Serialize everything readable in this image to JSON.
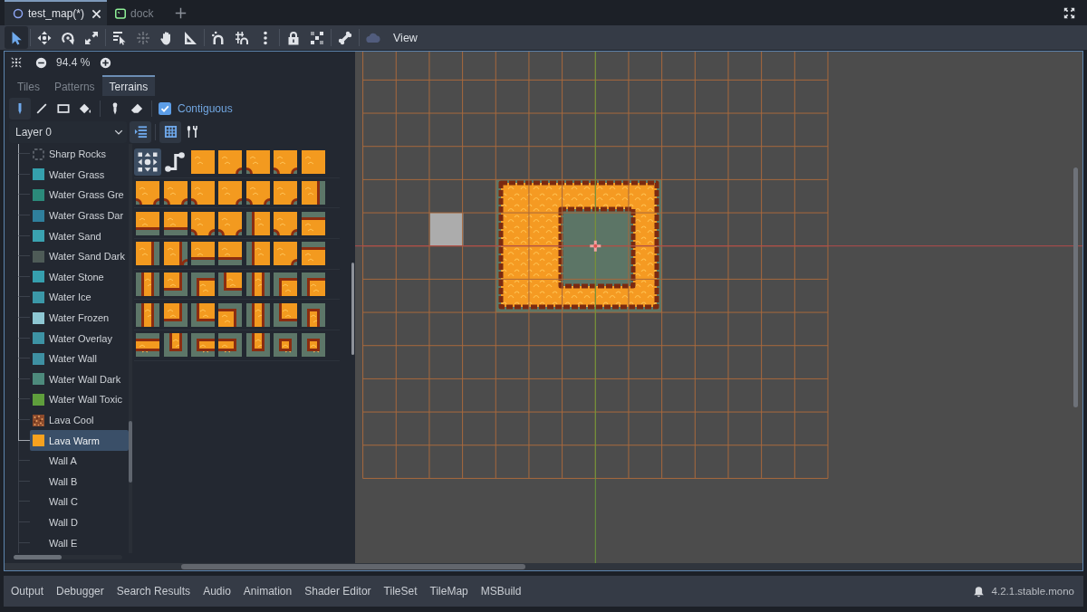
{
  "editor_tabs": [
    {
      "label": "test_map(*)",
      "kind": "circle",
      "selected": true
    },
    {
      "label": "dock",
      "kind": "square",
      "selected": false
    }
  ],
  "toolbar": {
    "tools": [
      {
        "selected": true,
        "disabled": false
      },
      {
        "selected": false,
        "disabled": false
      },
      {
        "selected": false,
        "disabled": false
      },
      {
        "selected": false,
        "disabled": false
      },
      {
        "selected": false,
        "disabled": false
      },
      {
        "selected": false,
        "disabled": true
      },
      {
        "selected": false,
        "disabled": false
      },
      {
        "selected": false,
        "disabled": false
      },
      {
        "selected": false,
        "disabled": false
      },
      {
        "selected": false,
        "disabled": false
      },
      {
        "selected": false,
        "disabled": false
      },
      {
        "selected": false,
        "disabled": false
      },
      {
        "selected": false,
        "disabled": false
      },
      {
        "selected": false,
        "disabled": false
      },
      {
        "selected": false,
        "disabled": true
      }
    ],
    "view_menu": "View"
  },
  "tile_panel": {
    "zoom": "94.4 %",
    "tabs": [
      {
        "label": "Tiles",
        "selected": false
      },
      {
        "label": "Patterns",
        "selected": false
      },
      {
        "label": "Terrains",
        "selected": true
      }
    ],
    "paint_tools": [
      {
        "selected": true
      },
      {
        "selected": false
      },
      {
        "selected": false
      },
      {
        "selected": false
      },
      {
        "selected": false
      },
      {
        "selected": false
      }
    ],
    "contiguous": {
      "label": "Contiguous",
      "checked": true
    },
    "layer": {
      "value": "Layer 0"
    },
    "view_toggles": [
      {
        "selected": true
      },
      {
        "selected": true
      },
      {
        "selected": false
      }
    ],
    "terrains": [
      {
        "name": "Sharp Rocks",
        "kind": "outline",
        "selected": false
      },
      {
        "name": "Water Grass",
        "kind": "color",
        "color": "#35a0ad",
        "selected": false
      },
      {
        "name": "Water Grass Gre",
        "kind": "color",
        "color": "#2b8a7a",
        "selected": false
      },
      {
        "name": "Water Grass Dar",
        "kind": "color",
        "color": "#2f7f9c",
        "selected": false
      },
      {
        "name": "Water Sand",
        "kind": "color",
        "color": "#3aa2b0",
        "selected": false
      },
      {
        "name": "Water Sand Dark",
        "kind": "color",
        "color": "#4e5b57",
        "selected": false
      },
      {
        "name": "Water Stone",
        "kind": "color",
        "color": "#369fae",
        "selected": false
      },
      {
        "name": "Water Ice",
        "kind": "color",
        "color": "#3b98a8",
        "selected": false
      },
      {
        "name": "Water Frozen",
        "kind": "color",
        "color": "#8ec7d3",
        "selected": false
      },
      {
        "name": "Water Overlay",
        "kind": "color",
        "color": "#3d93a4",
        "selected": false
      },
      {
        "name": "Water Wall",
        "kind": "color",
        "color": "#3e90a2",
        "selected": false
      },
      {
        "name": "Water Wall Dark",
        "kind": "color",
        "color": "#4d8a7c",
        "selected": false
      },
      {
        "name": "Water Wall Toxic",
        "kind": "color",
        "color": "#5f9e3c",
        "selected": false
      },
      {
        "name": "Lava Cool",
        "kind": "texture",
        "color": "#8b4a2b",
        "selected": false
      },
      {
        "name": "Lava Warm",
        "kind": "color",
        "color": "#f7a21f",
        "selected": true
      },
      {
        "name": "Wall A",
        "kind": "plain",
        "selected": false
      },
      {
        "name": "Wall B",
        "kind": "plain",
        "selected": false
      },
      {
        "name": "Wall C",
        "kind": "plain",
        "selected": false
      },
      {
        "name": "Wall D",
        "kind": "plain",
        "selected": false
      },
      {
        "name": "Wall E",
        "kind": "plain",
        "selected": false
      }
    ],
    "paint_modes": [
      {
        "selected": true
      },
      {
        "selected": false
      }
    ]
  },
  "bottom_panel": {
    "tabs": [
      {
        "label": "Output",
        "selected": false
      },
      {
        "label": "Debugger",
        "selected": false
      },
      {
        "label": "Search Results",
        "selected": false
      },
      {
        "label": "Audio",
        "selected": false
      },
      {
        "label": "Animation",
        "selected": false
      },
      {
        "label": "Shader Editor",
        "selected": false
      },
      {
        "label": "TileSet",
        "selected": false
      },
      {
        "label": "TileMap",
        "selected": false
      },
      {
        "label": "MSBuild",
        "selected": false
      }
    ],
    "version": "4.2.1.stable.mono"
  }
}
